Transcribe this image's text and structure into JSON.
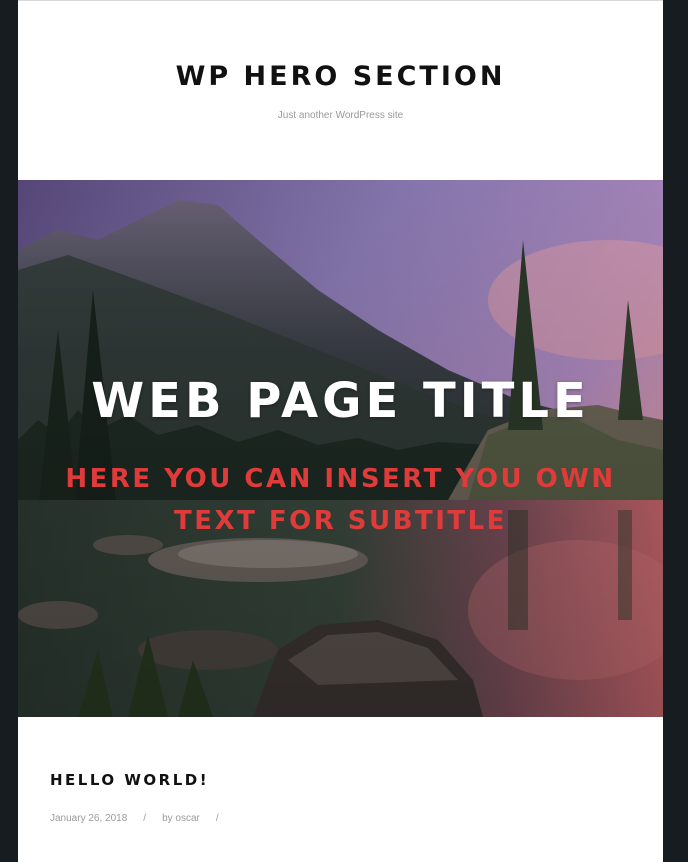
{
  "site": {
    "title": "WP HERO SECTION",
    "tagline": "Just another WordPress site"
  },
  "hero": {
    "title": "WEB PAGE TITLE",
    "subtitle": "HERE YOU CAN INSERT YOU OWN TEXT FOR SUBTITLE",
    "title_color": "#ffffff",
    "subtitle_color": "#e03b3b"
  },
  "post": {
    "title": "HELLO WORLD!",
    "date": "January 26, 2018",
    "separator": "/",
    "author": "by oscar"
  },
  "colors": {
    "frame": "#171c20",
    "page": "#ffffff"
  }
}
